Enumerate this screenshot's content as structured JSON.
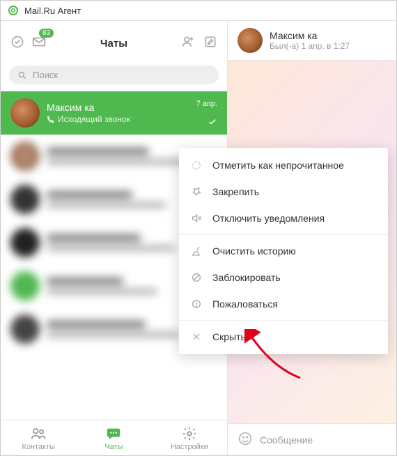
{
  "app": {
    "title": "Mail.Ru Агент"
  },
  "toolbar": {
    "title": "Чаты",
    "badge": "83"
  },
  "search": {
    "placeholder": "Поиск"
  },
  "selected_chat": {
    "name": "Максим ка",
    "subtitle": "Исходящий звонок",
    "date": "7 апр."
  },
  "context_menu": {
    "mark_unread": "Отметить как непрочитанное",
    "pin": "Закрепить",
    "mute": "Отключить уведомления",
    "clear": "Очистить историю",
    "block": "Заблокировать",
    "report": "Пожаловаться",
    "hide": "Скрыть"
  },
  "bottom_nav": {
    "contacts": "Контакты",
    "chats": "Чаты",
    "settings": "Настройки"
  },
  "right_header": {
    "name": "Максим ка",
    "status": "Был(-а) 1 апр. в 1:27"
  },
  "composer": {
    "placeholder": "Сообщение"
  }
}
